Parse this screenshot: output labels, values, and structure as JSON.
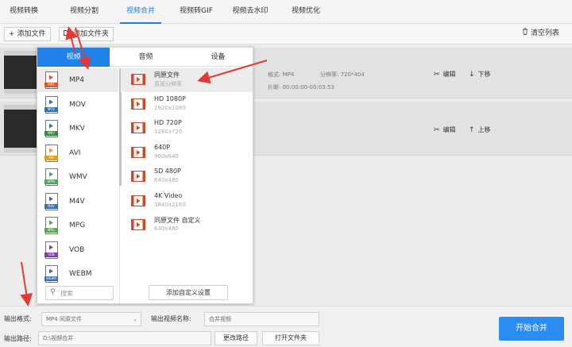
{
  "nav_tabs": [
    "视频转换",
    "视频分割",
    "视频合并",
    "视频转GIF",
    "视频去水印",
    "视频优化"
  ],
  "toolbar": {
    "add_file": "添加文件",
    "add_folder": "添加文件夹",
    "clear_list": "清空列表"
  },
  "rows": [
    {
      "format_label": "格式:",
      "format_value": "MP4",
      "res_label": "分辨率:",
      "res_value": "720*404",
      "dur_label": "片断:",
      "dur_value": "00:00:00-00:03:53",
      "edit": "编辑",
      "move": "下移"
    },
    {
      "edit": "编辑",
      "move": "上移"
    }
  ],
  "popup": {
    "tabs": [
      "视频",
      "音频",
      "设备"
    ],
    "formats": [
      {
        "name": "MP4",
        "label": "MP4",
        "color": "#d9582b"
      },
      {
        "name": "MOV",
        "label": "MOV",
        "color": "#2d6fb0"
      },
      {
        "name": "MKV",
        "label": "MKV",
        "color": "#2e8b3e"
      },
      {
        "name": "AVI",
        "label": "AVI",
        "color": "#e39b1a"
      },
      {
        "name": "WMV",
        "label": "WMV",
        "color": "#4aa55a"
      },
      {
        "name": "M4V",
        "label": "M4V",
        "color": "#3b6fb5"
      },
      {
        "name": "MPG",
        "label": "MPG",
        "color": "#56a84b"
      },
      {
        "name": "VOB",
        "label": "VOB",
        "color": "#7b3fb0"
      },
      {
        "name": "WEBM",
        "label": "WEBM",
        "color": "#3a6db5"
      }
    ],
    "search_placeholder": "搜索",
    "presets": [
      {
        "name": "同原文件",
        "res": "原视分辨率"
      },
      {
        "name": "HD 1080P",
        "res": "1920x1080"
      },
      {
        "name": "HD 720P",
        "res": "1280x720"
      },
      {
        "name": "640P",
        "res": "960x640"
      },
      {
        "name": "SD 480P",
        "res": "640x480"
      },
      {
        "name": "4K Video",
        "res": "3840x2160"
      },
      {
        "name": "同原文件 自定义",
        "res": "640x480"
      }
    ],
    "custom_button": "添加自定义设置"
  },
  "bottom": {
    "format_label": "输出格式:",
    "format_value": "MP4  同原文件",
    "name_label": "输出视频名称:",
    "name_value": "合并视频",
    "path_label": "输出路径:",
    "path_value": "D:\\视频合并",
    "change_path": "更改路径",
    "open_folder": "打开文件夹",
    "start": "开始合并"
  },
  "colors": {
    "accent": "#1e82e8",
    "start_button": "#2b8cf2",
    "preset_icon": "#d04a2a",
    "arrow": "#e53935"
  }
}
